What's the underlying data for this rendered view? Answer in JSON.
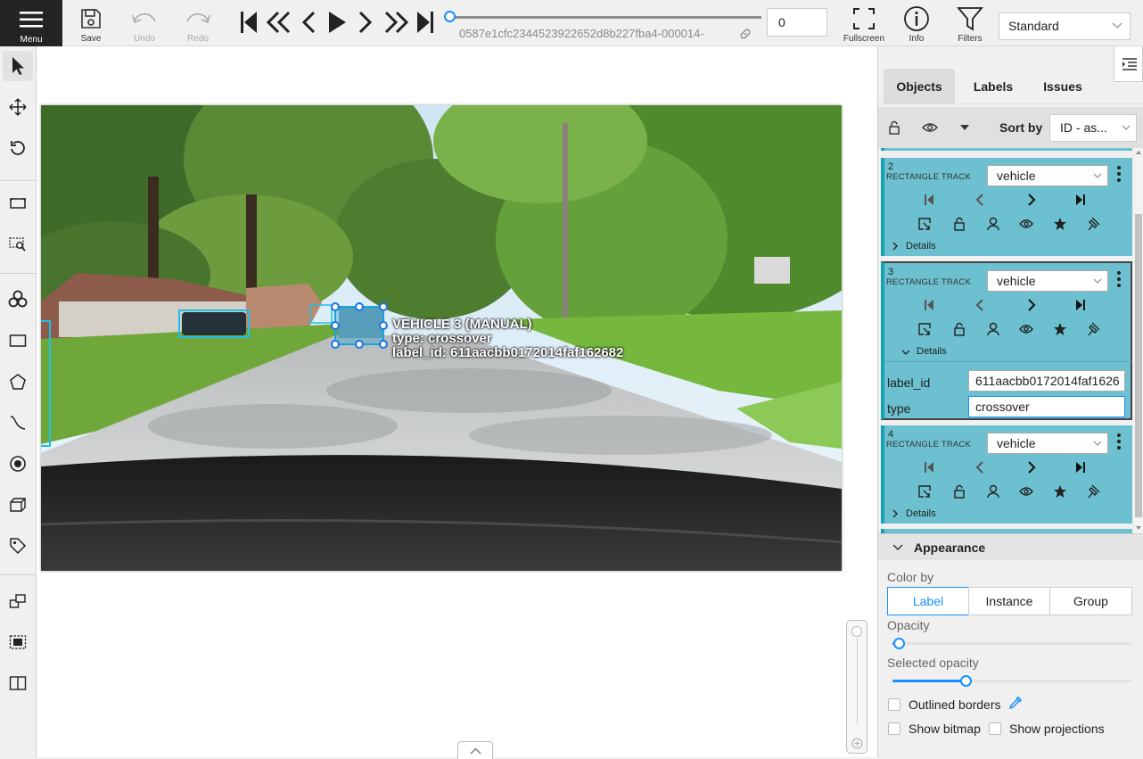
{
  "toolbar": {
    "menu_label": "Menu",
    "save_label": "Save",
    "undo_label": "Undo",
    "redo_label": "Redo",
    "frame_name": "0587e1cfc2344523922652d8b227fba4-000014-",
    "frame_number": "0",
    "fullscreen_label": "Fullscreen",
    "info_label": "Info",
    "filters_label": "Filters",
    "workspace": "Standard",
    "player_progress": 0.0
  },
  "canvas": {
    "annotation": {
      "title": "VEHICLE 3 (MANUAL)",
      "type_line": "type: crossover",
      "label_line": "label_id: 611aacbb0172014faf162682"
    }
  },
  "sidebar": {
    "tabs": [
      "Objects",
      "Labels",
      "Issues"
    ],
    "active_tab": "Objects",
    "sort_label": "Sort by",
    "sort_value": "ID - as...",
    "objects": [
      {
        "id": "2",
        "type": "RECTANGLE TRACK",
        "label": "vehicle",
        "details_label": "Details",
        "expanded": false
      },
      {
        "id": "3",
        "type": "RECTANGLE TRACK",
        "label": "vehicle",
        "details_label": "Details",
        "expanded": true,
        "attributes": [
          {
            "name": "label_id",
            "value": "611aacbb0172014faf1626"
          },
          {
            "name": "type",
            "value": "crossover"
          }
        ]
      },
      {
        "id": "4",
        "type": "RECTANGLE TRACK",
        "label": "vehicle",
        "details_label": "Details",
        "expanded": false
      }
    ]
  },
  "appearance": {
    "title": "Appearance",
    "color_by_label": "Color by",
    "color_by_options": [
      "Label",
      "Instance",
      "Group"
    ],
    "color_by_selected": "Label",
    "opacity_label": "Opacity",
    "opacity_value": 0.03,
    "selected_opacity_label": "Selected opacity",
    "selected_opacity_value": 0.3,
    "outlined_borders_label": "Outlined borders",
    "show_bitmap_label": "Show bitmap",
    "show_projections_label": "Show projections"
  },
  "colors": {
    "accent": "#1890ff",
    "object_card": "#6cc0cf",
    "object_card_border": "#17a2b8",
    "menu_bg": "#242424"
  }
}
